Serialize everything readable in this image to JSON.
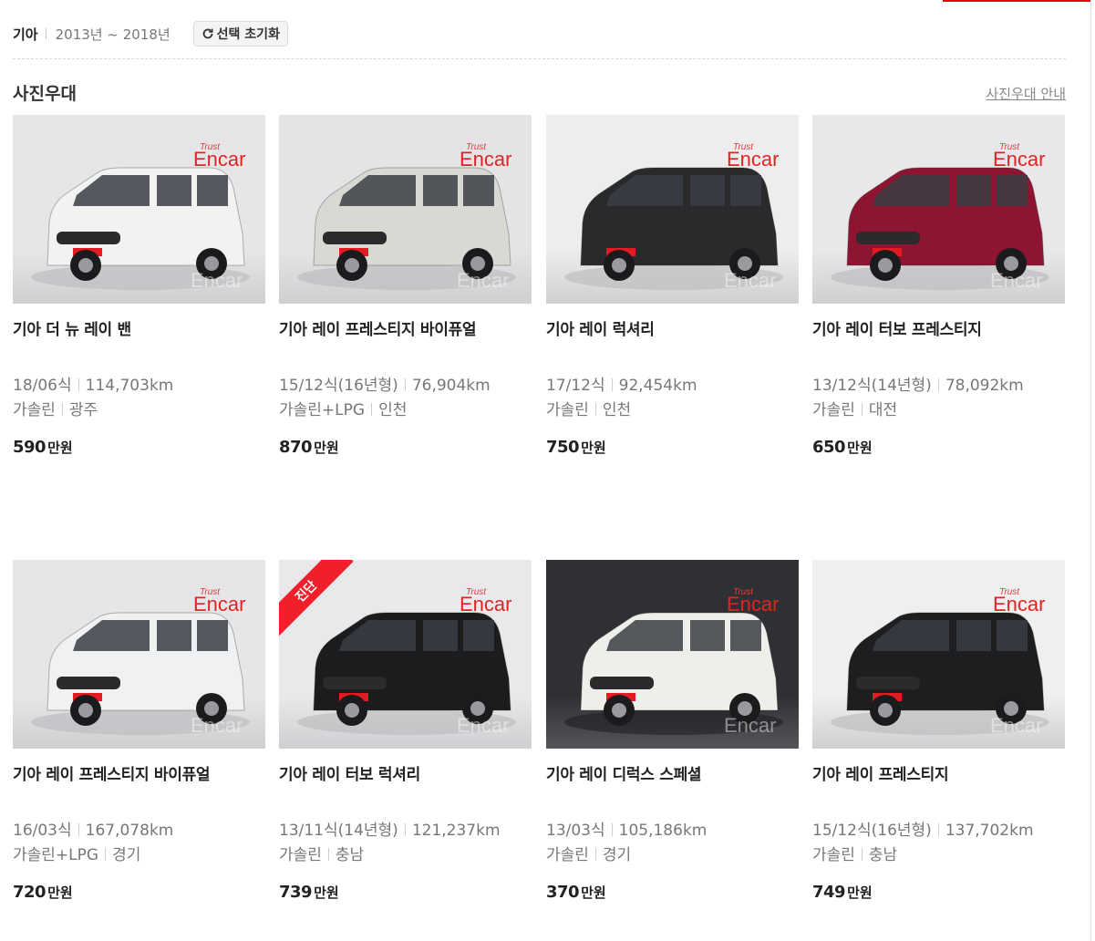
{
  "filter": {
    "maker": "기아",
    "years": "2013년 ~ 2018년",
    "reset_label": "선택 초기화"
  },
  "section": {
    "title": "사진우대",
    "guide_link": "사진우대 안내"
  },
  "price_unit": "만원",
  "listings": [
    {
      "name": "기아 더 뉴 레이 밴",
      "year": "18/06식",
      "mileage": "114,703km",
      "fuel": "가솔린",
      "region": "광주",
      "price": "590",
      "color": "#f2f2f2",
      "bg": "#e6e6e8",
      "badge": ""
    },
    {
      "name": "기아 레이 프레스티지 바이퓨얼",
      "year": "15/12식(16년형)",
      "mileage": "76,904km",
      "fuel": "가솔린+LPG",
      "region": "인천",
      "price": "870",
      "color": "#d9d9d4",
      "bg": "#e4e4e6",
      "badge": ""
    },
    {
      "name": "기아 레이 럭셔리",
      "year": "17/12식",
      "mileage": "92,454km",
      "fuel": "가솔린",
      "region": "인천",
      "price": "750",
      "color": "#2a2a2c",
      "bg": "#ededee",
      "badge": ""
    },
    {
      "name": "기아 레이 터보 프레스티지",
      "year": "13/12식(14년형)",
      "mileage": "78,092km",
      "fuel": "가솔린",
      "region": "대전",
      "price": "650",
      "color": "#8e1531",
      "bg": "#e8e8ea",
      "badge": ""
    },
    {
      "name": "기아 레이 프레스티지 바이퓨얼",
      "year": "16/03식",
      "mileage": "167,078km",
      "fuel": "가솔린+LPG",
      "region": "경기",
      "price": "720",
      "color": "#f0f1f3",
      "bg": "#e6e6e8",
      "badge": ""
    },
    {
      "name": "기아 레이 터보 럭셔리",
      "year": "13/11식(14년형)",
      "mileage": "121,237km",
      "fuel": "가솔린",
      "region": "충남",
      "price": "739",
      "color": "#1c1c1e",
      "bg": "#e9e9eb",
      "badge": "진단"
    },
    {
      "name": "기아 레이 디럭스 스페셜",
      "year": "13/03식",
      "mileage": "105,186km",
      "fuel": "가솔린",
      "region": "경기",
      "price": "370",
      "color": "#eeeeea",
      "bg": "#2f3033",
      "badge": ""
    },
    {
      "name": "기아 레이 프레스티지",
      "year": "15/12식(16년형)",
      "mileage": "137,702km",
      "fuel": "가솔린",
      "region": "충남",
      "price": "749",
      "color": "#1e1e20",
      "bg": "#efeff0",
      "badge": ""
    }
  ],
  "watermark": {
    "brand": "Encar",
    "small": "Trust",
    "plate": "Encar"
  }
}
